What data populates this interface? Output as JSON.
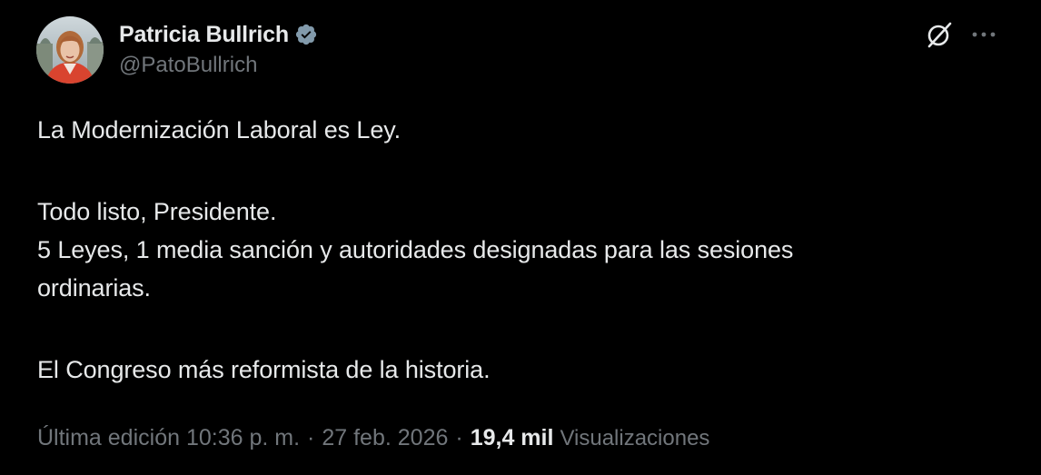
{
  "author": {
    "display_name": "Patricia Bullrich",
    "handle": "@PatoBullrich",
    "verified": true,
    "verified_color": "#829aab"
  },
  "tweet": {
    "lines": [
      "La Modernización Laboral es Ley.",
      "Todo listo, Presidente.",
      "5 Leyes, 1 media sanción y autoridades designadas para las sesiones",
      "ordinarias.",
      "El Congreso más reformista de la historia."
    ]
  },
  "meta": {
    "edited_time": "Última edición 10:36 p. m.",
    "separator": "·",
    "date": "27 feb. 2026",
    "views_count": "19,4 mil",
    "views_label": "Visualizaciones"
  },
  "actions": {
    "grok_icon": "grok-icon",
    "more_icon": "more-icon"
  },
  "colors": {
    "background": "#000000",
    "primary_text": "#e7e9ea",
    "secondary_text": "#71767b"
  }
}
